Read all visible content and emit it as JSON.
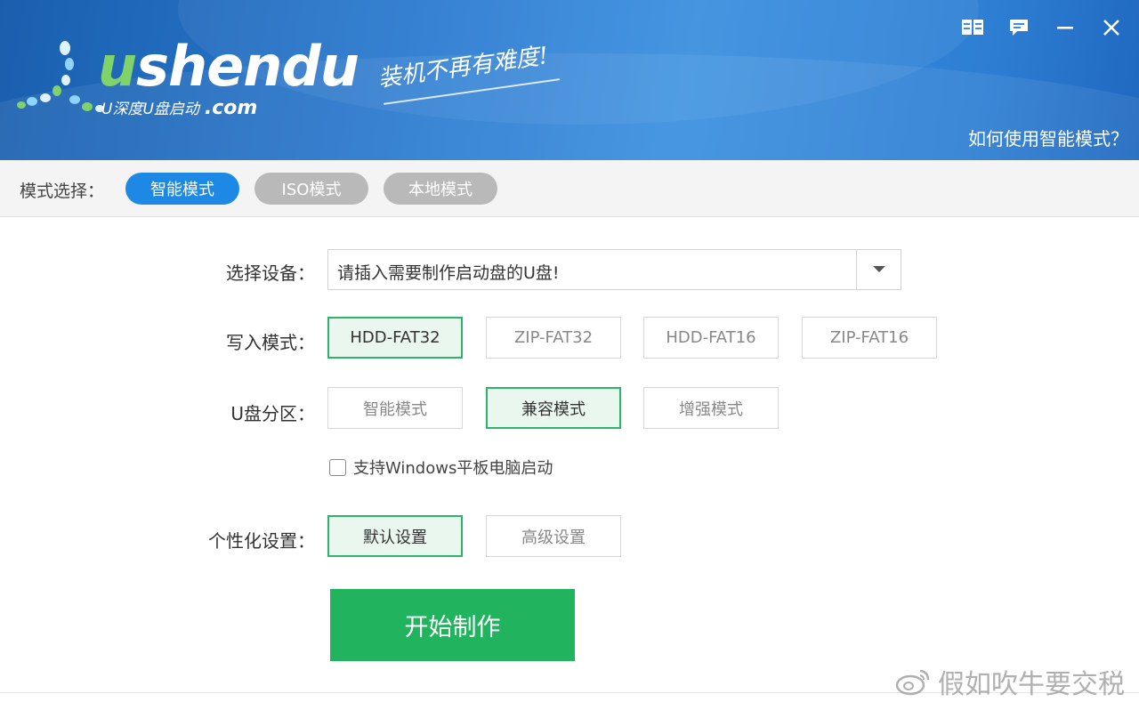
{
  "header": {
    "logo_text": "ushendu",
    "logo_sub": "U深度U盘启动",
    "logo_domain": ".com",
    "slogan": "装机不再有难度!",
    "help_link": "如何使用智能模式？"
  },
  "window_controls": [
    "book-icon",
    "feedback-icon",
    "minimize-icon",
    "close-icon"
  ],
  "mode_bar": {
    "label": "模式选择：",
    "modes": [
      {
        "label": "智能模式",
        "active": true
      },
      {
        "label": "ISO模式",
        "active": false
      },
      {
        "label": "本地模式",
        "active": false
      }
    ]
  },
  "form": {
    "device": {
      "label": "选择设备：",
      "value": "请插入需要制作启动盘的U盘!"
    },
    "write_mode": {
      "label": "写入模式：",
      "options": [
        "HDD-FAT32",
        "ZIP-FAT32",
        "HDD-FAT16",
        "ZIP-FAT16"
      ],
      "selected": "HDD-FAT32"
    },
    "partition": {
      "label": "U盘分区：",
      "options": [
        "智能模式",
        "兼容模式",
        "增强模式"
      ],
      "selected": "兼容模式"
    },
    "tablet_checkbox": {
      "label": "支持Windows平板电脑启动",
      "checked": false
    },
    "personal": {
      "label": "个性化设置：",
      "options": [
        "默认设置",
        "高级设置"
      ],
      "selected": "默认设置"
    },
    "start_button": "开始制作"
  },
  "watermark": "假如吹牛要交税",
  "colors": {
    "header_blue": "#2a79cf",
    "active_pill": "#1e88e5",
    "inactive_pill": "#b9b9b9",
    "selected_green": "#2cb56a",
    "start_green": "#22b35e"
  }
}
